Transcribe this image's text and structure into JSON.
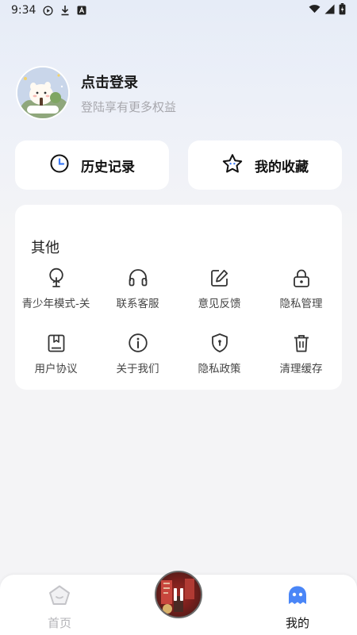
{
  "status_bar": {
    "time": "9:34",
    "left_icons": [
      "play-circle-icon",
      "download-icon",
      "a-square-icon"
    ],
    "right_icons": [
      "wifi-icon",
      "signal-icon",
      "battery-icon"
    ]
  },
  "profile": {
    "title": "点击登录",
    "subtitle": "登陆享有更多权益"
  },
  "quick_actions": [
    {
      "label": "历史记录",
      "icon": "clock-icon"
    },
    {
      "label": "我的收藏",
      "icon": "star-icon"
    }
  ],
  "other": {
    "title": "其他",
    "items": [
      {
        "label": "青少年模式-关",
        "icon": "seedling-icon"
      },
      {
        "label": "联系客服",
        "icon": "headphones-icon"
      },
      {
        "label": "意见反馈",
        "icon": "edit-icon"
      },
      {
        "label": "隐私管理",
        "icon": "lock-icon"
      },
      {
        "label": "用户协议",
        "icon": "bookmark-book-icon"
      },
      {
        "label": "关于我们",
        "icon": "info-icon"
      },
      {
        "label": "隐私政策",
        "icon": "shield-icon"
      },
      {
        "label": "清理缓存",
        "icon": "trash-icon"
      }
    ]
  },
  "bottom_nav": {
    "home_label": "首页",
    "mine_label": "我的"
  },
  "colors": {
    "accent": "#3d7bf5",
    "card": "#ffffff",
    "muted": "#a7a7ad"
  }
}
